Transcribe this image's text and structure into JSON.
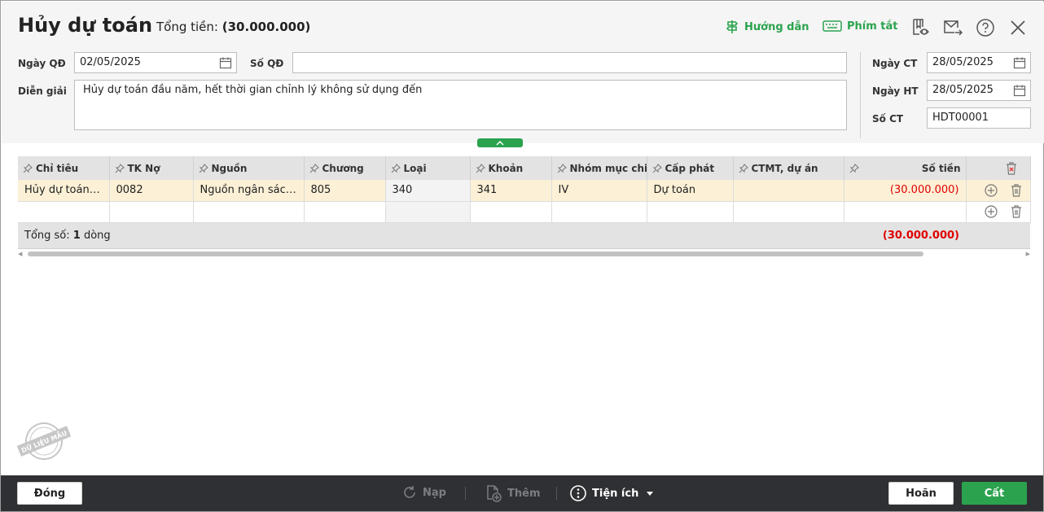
{
  "header": {
    "title": "Hủy dự toán",
    "total_label": "Tổng tiền:",
    "total_value": "(30.000.000)",
    "guide_label": "Hướng dẫn",
    "shortcut_label": "Phím tắt",
    "accent_color": "#2ba34e"
  },
  "form": {
    "ngay_qd_label": "Ngày QĐ",
    "ngay_qd_value": "02/05/2025",
    "so_qd_label": "Số QĐ",
    "so_qd_value": "",
    "dien_giai_label": "Diễn giải",
    "dien_giai_value": "Hủy dự toán đầu năm, hết thời gian chỉnh lý không sử dụng đến",
    "ngay_ct_label": "Ngày CT",
    "ngay_ct_value": "28/05/2025",
    "ngay_ht_label": "Ngày HT",
    "ngay_ht_value": "28/05/2025",
    "so_ct_label": "Số CT",
    "so_ct_value": "HDT00001"
  },
  "grid": {
    "columns": [
      "Chỉ tiêu",
      "TK Nợ",
      "Nguồn",
      "Chương",
      "Loại",
      "Khoản",
      "Nhóm mục chi",
      "Cấp phát",
      "CTMT, dự án",
      "Số tiền"
    ],
    "rows": [
      [
        "Hủy dự toán ...",
        "0082",
        "Nguồn ngân sách...",
        "805",
        "340",
        "341",
        "IV",
        "Dự toán",
        "",
        "(30.000.000)"
      ]
    ],
    "summary_prefix": "Tổng số: ",
    "summary_count": "1",
    "summary_suffix": " dòng",
    "summary_amount": "(30.000.000)",
    "negative_color": "#e00000"
  },
  "watermark": "DỮ LIỆU MẪU",
  "footer": {
    "close_label": "Đóng",
    "reload_label": "Nạp",
    "add_label": "Thêm",
    "utility_label": "Tiện ích",
    "cancel_label": "Hoãn",
    "save_label": "Cất"
  }
}
